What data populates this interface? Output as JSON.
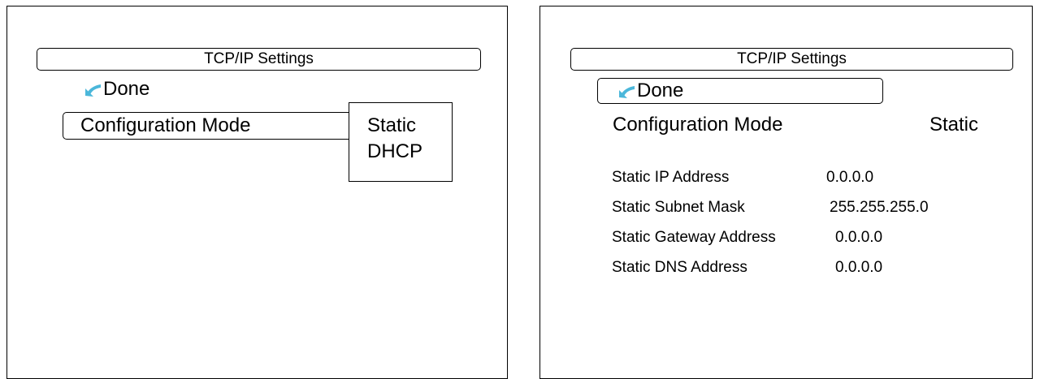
{
  "left_panel": {
    "title": "TCP/IP Settings",
    "done_label": "Done",
    "done_icon": "return-arrow-icon",
    "config_label": "Configuration Mode",
    "dropdown_options": [
      "Static",
      "DHCP"
    ]
  },
  "right_panel": {
    "title": "TCP/IP Settings",
    "done_label": "Done",
    "done_icon": "return-arrow-icon",
    "config_label": "Configuration Mode",
    "config_value": "Static",
    "fields": [
      {
        "label": "Static IP Address",
        "value": "0.0.0.0"
      },
      {
        "label": "Static Subnet Mask",
        "value": "255.255.255.0"
      },
      {
        "label": "Static Gateway Address",
        "value": "0.0.0.0"
      },
      {
        "label": "Static DNS Address",
        "value": "0.0.0.0"
      }
    ]
  },
  "colors": {
    "icon_accent": "#4bb7da",
    "border": "#000000",
    "background": "#ffffff"
  }
}
